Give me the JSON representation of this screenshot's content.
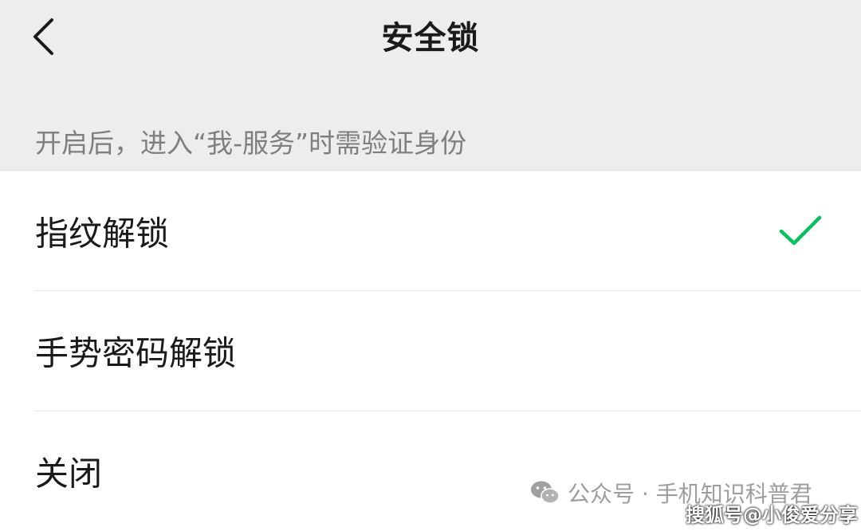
{
  "nav": {
    "title": "安全锁",
    "back_icon": "chevron-left-icon"
  },
  "hint": {
    "text": "开启后，进入“我-服务”时需验证身份"
  },
  "options": [
    {
      "label": "指纹解锁",
      "selected": true
    },
    {
      "label": "手势密码解锁",
      "selected": false
    },
    {
      "label": "关闭",
      "selected": false
    }
  ],
  "check_icon": "checkmark-icon",
  "colors": {
    "accent": "#07c160",
    "header_bg": "#ededed",
    "text_primary": "#1a1a1a",
    "text_secondary": "#7f7f7f"
  },
  "watermark": {
    "text": "公众号 · 手机知识科普君",
    "icon": "wechat-icon"
  },
  "source_stamp": {
    "text": "搜狐号@小俊爱分享"
  }
}
